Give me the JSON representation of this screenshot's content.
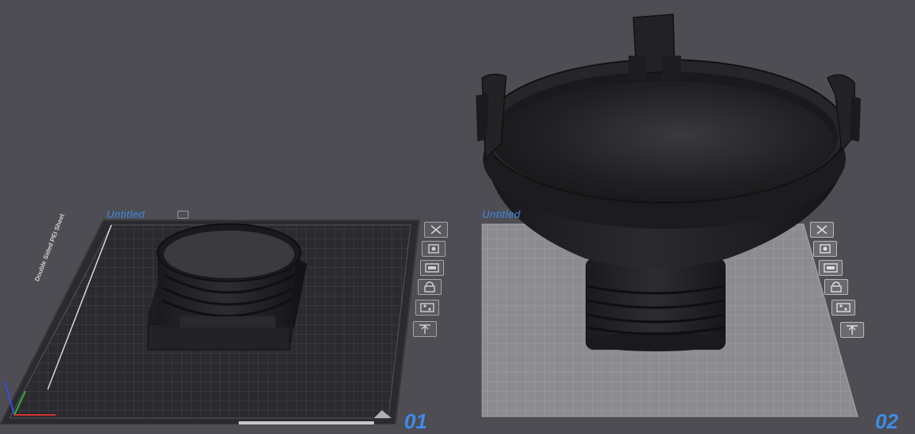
{
  "plates": [
    {
      "name": "Untitled",
      "index": "01",
      "bed_label": "Double Sided PEI Sheet",
      "tools": [
        "remove-icon",
        "arrange-icon",
        "orient-icon",
        "lock-icon",
        "settings-icon",
        "move-up-icon"
      ]
    },
    {
      "name": "Untitled",
      "index": "02",
      "tools": [
        "remove-icon",
        "arrange-icon",
        "orient-icon",
        "lock-icon",
        "settings-icon",
        "move-up-icon"
      ]
    }
  ],
  "colors": {
    "background": "#4d4d53",
    "plate_label": "#3f8be8",
    "plate_dark": "#2b2b2f",
    "plate_light": "#8c8c90",
    "model": "#1f1f22"
  }
}
